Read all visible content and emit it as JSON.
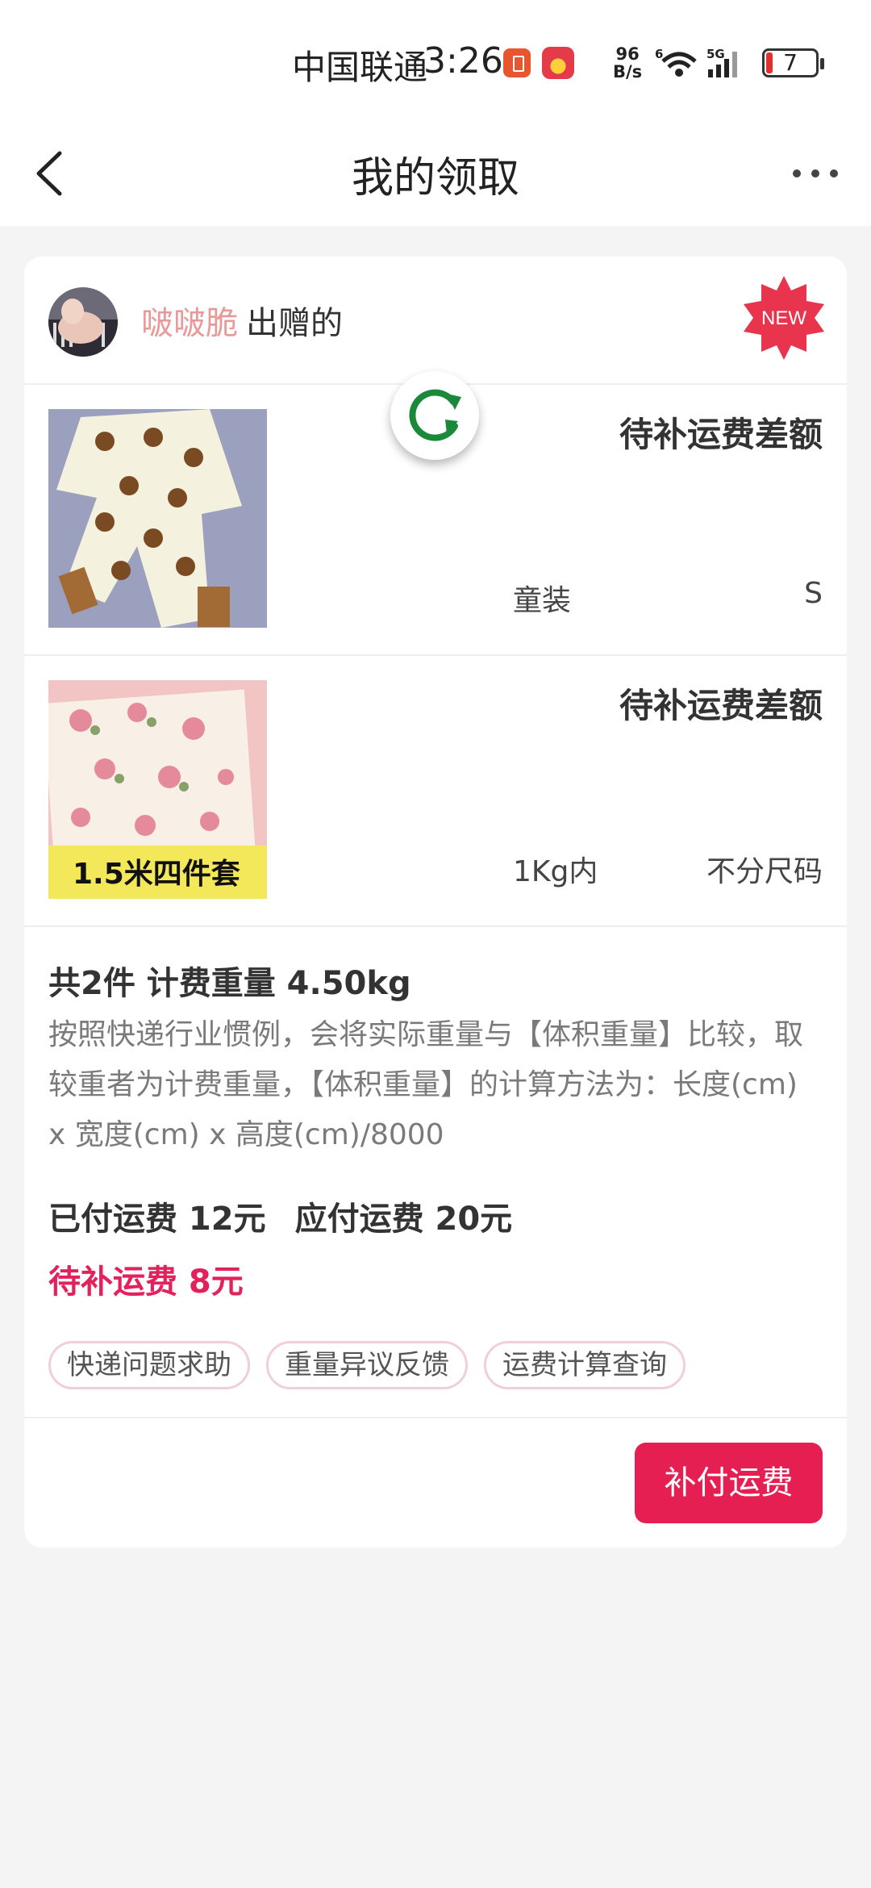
{
  "status_bar": {
    "carrier": "中国联通",
    "time": "3:26",
    "net_speed_value": "96",
    "net_speed_unit": "B/s",
    "battery_level": "7"
  },
  "nav": {
    "title": "我的领取",
    "back_icon": "chevron-left-icon",
    "more_icon": "more-horizontal-icon"
  },
  "giver": {
    "name": "啵啵脆",
    "suffix": "出赠的",
    "badge": "NEW"
  },
  "items": [
    {
      "status": "待补运费差额",
      "category": "童装",
      "size": "S",
      "thumb_desc": "bear-print-onesie"
    },
    {
      "status": "待补运费差额",
      "category": "1Kg内",
      "size": "不分尺码",
      "thumb_text": "1.5米四件套"
    }
  ],
  "summary": {
    "weight_line": "共2件 计费重量 4.50kg",
    "note": "按照快递行业惯例，会将实际重量与【体积重量】比较，取较重者为计费重量，【体积重量】的计算方法为：长度(cm) x 宽度(cm) x 高度(cm)/8000",
    "paid_fee": "已付运费 12元",
    "payable_fee": "应付运费 20元",
    "due_fee": "待补运费 8元"
  },
  "chips": [
    "快递问题求助",
    "重量异议反馈",
    "运费计算查询"
  ],
  "pay_button": "补付运费",
  "colors": {
    "accent": "#e51f52",
    "giver_name": "#e89a9a",
    "badge": "#e8354d",
    "refresh": "#1a8a3a"
  }
}
